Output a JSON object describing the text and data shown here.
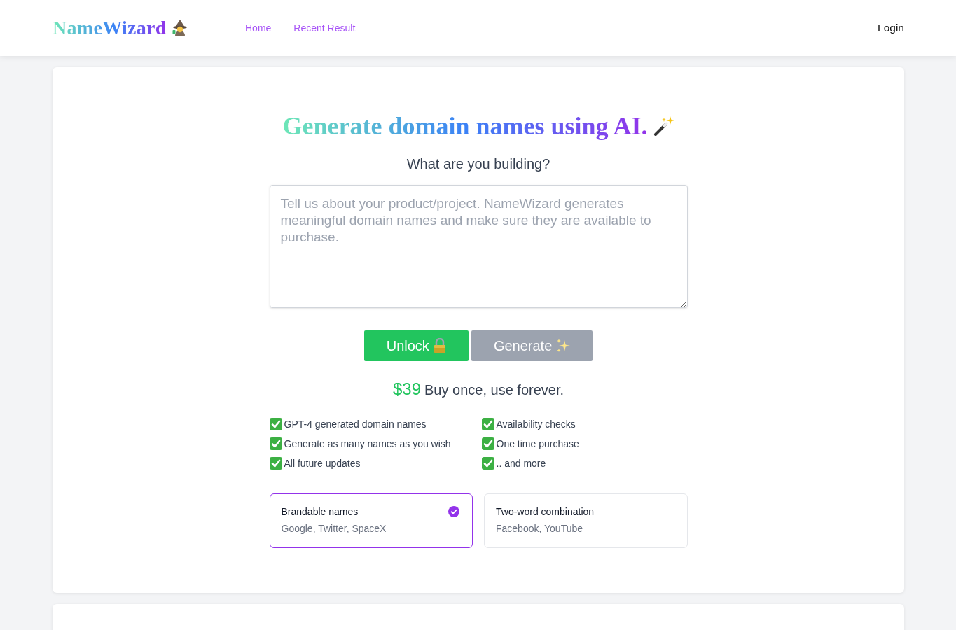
{
  "header": {
    "logo": "NameWizard",
    "nav": [
      {
        "label": "Home"
      },
      {
        "label": "Recent Result"
      }
    ],
    "login": "Login"
  },
  "hero": {
    "title": "Generate domain names using AI.",
    "question": "What are you building?",
    "description": {
      "placeholder": "Tell us about your product/project. NameWizard generates meaningful domain names and make sure they are available to purchase."
    }
  },
  "buttons": [
    {
      "kind": "unlock",
      "label": "Unlock",
      "disabled": false
    },
    {
      "kind": "generate",
      "label": "Generate",
      "disabled": true
    }
  ],
  "pricing": {
    "price": "$39",
    "tagline": "Buy once, use forever."
  },
  "features": [
    {
      "label": "GPT-4 generated domain names",
      "checked": true
    },
    {
      "label": "Availability checks",
      "checked": true
    },
    {
      "label": "Generate as many names as you wish",
      "checked": true
    },
    {
      "label": "One time purchase",
      "checked": true
    },
    {
      "label": "All future updates",
      "checked": true
    },
    {
      "label": ".. and more",
      "checked": true
    }
  ],
  "name_styles": [
    {
      "title": "Brandable names",
      "examples": "Google, Twitter, SpaceX",
      "selected": true
    },
    {
      "title": "Two-word combination",
      "examples": "Facebook, YouTube",
      "selected": false
    }
  ]
}
